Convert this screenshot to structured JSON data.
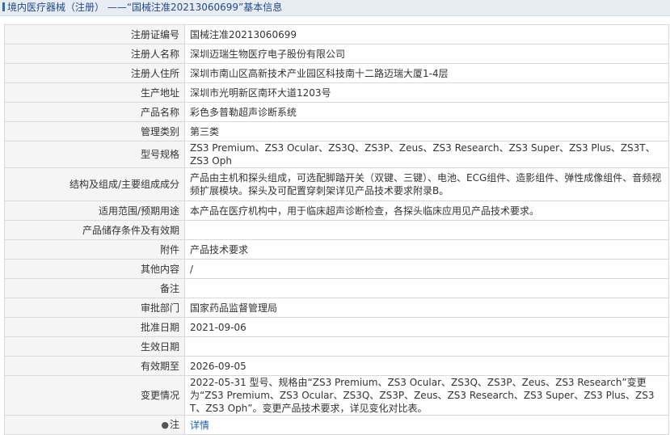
{
  "header": {
    "title": "境内医疗器械（注册） ——“国械注准20213060699”基本信息"
  },
  "rows": [
    {
      "label": "注册证编号",
      "value": "国械注准20213060699"
    },
    {
      "label": "注册人名称",
      "value": "深圳迈瑞生物医疗电子股份有限公司"
    },
    {
      "label": "注册人住所",
      "value": "深圳市南山区高新技术产业园区科技南十二路迈瑞大厦1-4层"
    },
    {
      "label": "生产地址",
      "value": "深圳市光明新区南环大道1203号"
    },
    {
      "label": "产品名称",
      "value": "彩色多普勒超声诊断系统"
    },
    {
      "label": "管理类别",
      "value": "第三类"
    },
    {
      "label": "型号规格",
      "value": "ZS3 Premium、ZS3 Ocular、ZS3Q、ZS3P、Zeus、ZS3 Research、ZS3 Super、ZS3 Plus、ZS3T、ZS3 Oph"
    },
    {
      "label": "结构及组成/主要组成成分",
      "value": "产品由主机和探头组成，可选配脚踏开关（双键、三键）、电池、ECG组件、造影组件、弹性成像组件、音频视频扩展模块。探头及可配置穿刺架详见产品技术要求附录B。"
    },
    {
      "label": "适用范围/预期用途",
      "value": "本产品在医疗机构中，用于临床超声诊断检查，各探头临床应用见产品技术要求。"
    },
    {
      "label": "产品储存条件及有效期",
      "value": ""
    },
    {
      "label": "附件",
      "value": "产品技术要求"
    },
    {
      "label": "其他内容",
      "value": "/"
    },
    {
      "label": "备注",
      "value": ""
    },
    {
      "label": "审批部门",
      "value": "国家药品监督管理局"
    },
    {
      "label": "批准日期",
      "value": "2021-09-06"
    },
    {
      "label": "生效日期",
      "value": ""
    },
    {
      "label": "有效期至",
      "value": "2026-09-05"
    },
    {
      "label": "变更情况",
      "value": "2022-05-31 型号、规格由“ZS3 Premium、ZS3 Ocular、ZS3Q、ZS3P、Zeus、ZS3 Research”变更为“ZS3 Premium、ZS3 Ocular、ZS3Q、ZS3P、Zeus、ZS3 Research、ZS3 Super、ZS3 Plus、ZS3T、ZS3 Oph”。变更产品技术要求，详见变化对比表。"
    }
  ],
  "note_row": {
    "icon": "pin-icon",
    "label": "注",
    "link": "详情"
  }
}
